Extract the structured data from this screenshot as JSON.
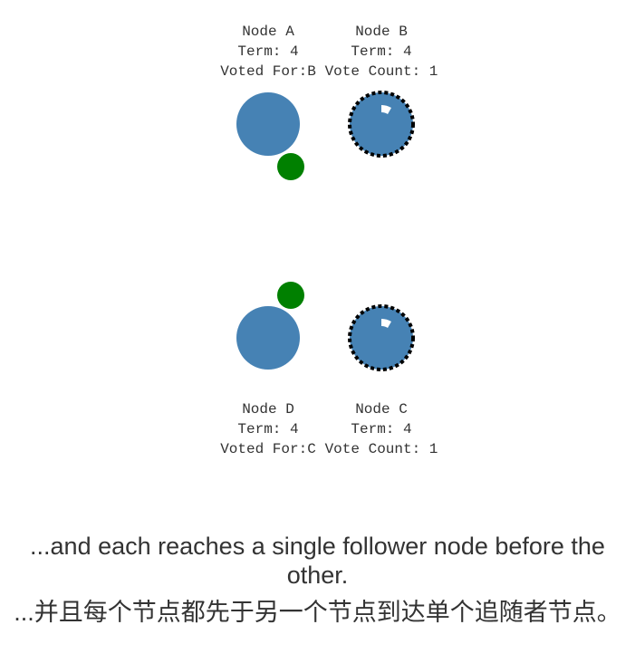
{
  "colors": {
    "node_fill": "#4682b4",
    "node_border_candidate": "#000000",
    "message": "#008000",
    "timeout_arc": "#ffffff",
    "text": "#333333"
  },
  "nodes": [
    {
      "id": "A",
      "name": "Node A",
      "term": "Term: 4",
      "detail": "Voted For:",
      "detail_value": "B",
      "state": "follower"
    },
    {
      "id": "B",
      "name": "Node B",
      "term": "Term: 4",
      "detail": "Vote Count: 1",
      "state": "candidate"
    },
    {
      "id": "C",
      "name": "Node C",
      "term": "Term: 4",
      "detail": "Vote Count: 1",
      "state": "candidate"
    },
    {
      "id": "D",
      "name": "Node D",
      "term": "Term: 4",
      "detail": "Voted For:",
      "detail_value": "C",
      "state": "follower"
    }
  ],
  "messages": [
    {
      "from": "A",
      "to": "B",
      "kind": "vote-response"
    },
    {
      "from": "D",
      "to": "C",
      "kind": "vote-response"
    }
  ],
  "caption": {
    "en": "...and each reaches a single follower node before the other.",
    "zh": "...并且每个节点都先于另一个节点到达单个追随者节点。"
  }
}
